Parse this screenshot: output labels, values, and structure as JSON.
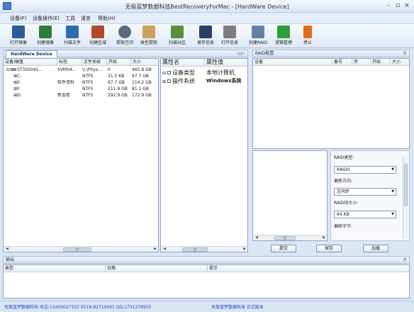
{
  "window": {
    "title": "无极蓝梦数据科技BestRecoveryForMac - [HardWare Device]",
    "minimize": "–",
    "restore": "▫",
    "close": "×"
  },
  "menu": [
    "设备(F)",
    "设备操作(E)",
    "工具",
    "语言",
    "帮助(H)"
  ],
  "toolbar": [
    {
      "label": "打开镜像",
      "icon": "open-image-icon",
      "color": "#2a5d9a"
    },
    {
      "label": "创建镜像",
      "icon": "create-image-icon",
      "color": "#2f7d3a"
    },
    {
      "label": "扫描文件",
      "icon": "scan-file-icon",
      "color": "#2b6db3"
    },
    {
      "label": "创建区域",
      "icon": "create-region-icon",
      "color": "#b04a2e"
    },
    {
      "label": "提取空间",
      "icon": "extract-space-icon",
      "color": "#5a6b80"
    },
    {
      "label": "类型提取",
      "icon": "type-extract-icon",
      "color": "#c9a35a"
    },
    {
      "label": "扫描分区",
      "icon": "scan-partition-icon",
      "color": "#5c8f3d"
    },
    {
      "label": "保存信息",
      "icon": "save-info-icon",
      "color": "#2c3e66"
    },
    {
      "label": "打开信息",
      "icon": "open-info-icon",
      "color": "#7d7d7d"
    },
    {
      "label": "创建RAID",
      "icon": "create-raid-icon",
      "color": "#6a7fa8"
    },
    {
      "label": "逻辑管理",
      "icon": "logic-manage-icon",
      "color": "#2f9c3a"
    },
    {
      "label": "停止",
      "icon": "stop-icon",
      "color": "#e36b1a"
    }
  ],
  "device_panel": {
    "tab": "HardWare Device",
    "nav": "◁ ▷",
    "columns": [
      "设备/硬盘",
      "标签",
      "文件系统",
      "开始",
      "大小"
    ],
    "rows": [
      {
        "toggle": "⊟",
        "name": "ST350041…",
        "label": "SVM04…",
        "fs": "\\\\.\\Phys…",
        "start": "0",
        "size": "465.8 GB"
      },
      {
        "toggle": "⊞",
        "name": "C:",
        "label": "",
        "fs": "NTFS",
        "start": "31.5 KB",
        "size": "97.7 GB"
      },
      {
        "toggle": "⊞",
        "name": "E:",
        "label": "软件资料",
        "fs": "NTFS",
        "start": "97.7 GB",
        "size": "114.2 GB"
      },
      {
        "toggle": "⊞",
        "name": "F:",
        "label": "",
        "fs": "NTFS",
        "start": "211.9 GB",
        "size": "81.1 GB"
      },
      {
        "toggle": "⊞",
        "name": "D:",
        "label": "新加卷",
        "fs": "NTFS",
        "start": "292.9 GB",
        "size": "172.9 GB"
      }
    ],
    "scroll_thumb": "|||"
  },
  "property_panel": {
    "columns": [
      "属性名",
      "属性值"
    ],
    "rows": [
      {
        "toggle": "⊟",
        "name": "设备类型",
        "value": "本地计算机"
      },
      {
        "toggle": "⊞",
        "name": "操作系统",
        "value": "Windows系统"
      }
    ],
    "scroll_thumb": "|||"
  },
  "raid_panel": {
    "title": "RAID配置",
    "pin": "0",
    "columns": [
      "设备",
      "备号",
      "序",
      "开始",
      "大小"
    ],
    "type_label": "RAID类型:",
    "type_value": "RAID0",
    "dir_label": "偏移方向:",
    "dir_value": "左同步",
    "block_label": "RAID块大小:",
    "block_value": "64 KB",
    "offset_label": "偏移字节:",
    "submit": "提交",
    "save": "保存",
    "load": "加载",
    "scroll_thumb": "|||"
  },
  "output": {
    "title": "输出",
    "pin": "0",
    "columns": [
      "类型",
      "日期",
      "提示"
    ]
  },
  "status": {
    "left": "无极蓝梦数据科技 电话:13400027332 0519-82719091 QQ:1731278955",
    "right": "无极蓝梦数据科技 正式版本"
  }
}
